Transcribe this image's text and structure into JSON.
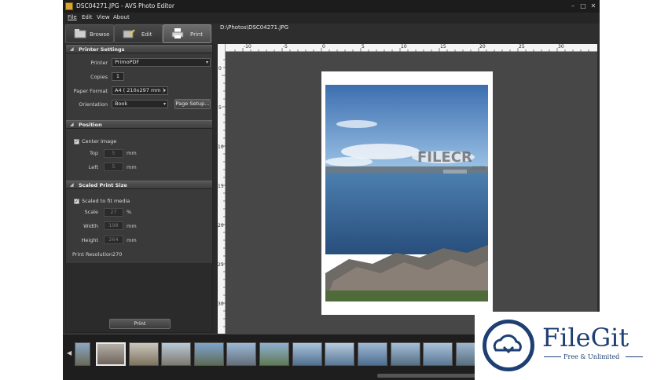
{
  "window": {
    "title": "DSC04271.JPG - AVS Photo Editor",
    "minimize": "–",
    "maximize": "□",
    "close": "✕"
  },
  "menu": [
    "File",
    "Edit",
    "View",
    "About"
  ],
  "tabs": [
    {
      "label": "Browse",
      "icon": "browse-icon",
      "active": false
    },
    {
      "label": "Edit",
      "icon": "edit-icon",
      "active": false
    },
    {
      "label": "Print",
      "icon": "printer-icon",
      "active": true
    }
  ],
  "file_path": "D:\\Photos\\DSC04271.JPG",
  "printer_settings": {
    "title": "Printer Settings",
    "printer_label": "Printer",
    "printer_value": "PrimoPDF",
    "copies_label": "Copies",
    "copies_value": "1",
    "paper_label": "Paper Format",
    "paper_value": "A4 ( 210x297 mm )",
    "orientation_label": "Orientation",
    "orientation_value": "Book",
    "page_setup_label": "Page Setup..."
  },
  "position": {
    "title": "Position",
    "center_label": "Center image",
    "center_checked": true,
    "top_label": "Top",
    "top_value": "5",
    "top_unit": "mm",
    "left_label": "Left",
    "left_value": "5",
    "left_unit": "mm"
  },
  "scaled": {
    "title": "Scaled Print Size",
    "fit_label": "Scaled to fit media",
    "fit_checked": true,
    "scale_label": "Scale",
    "scale_value": "27",
    "scale_unit": "%",
    "width_label": "Width",
    "width_value": "198",
    "width_unit": "mm",
    "height_label": "Height",
    "height_value": "264",
    "height_unit": "mm",
    "resolution_label": "Print Resolution",
    "resolution_value": "270"
  },
  "print_button": "Print",
  "ruler": {
    "h_unit": "cm",
    "h_ticks": [
      "-10",
      "-5",
      "0",
      "5",
      "10",
      "15",
      "20",
      "25",
      "30"
    ],
    "v_ticks": [
      "0",
      "5",
      "10",
      "15",
      "20",
      "25",
      "30"
    ]
  },
  "watermark": {
    "text": "FILECR",
    "sub": ".com"
  },
  "filmstrip": {
    "count": 13,
    "active_index": 1,
    "prev": "◀"
  },
  "filegit": {
    "name": "FileGit",
    "tagline": "Free & Unlimited"
  },
  "colors": {
    "accent": "#1e3f73",
    "panel": "#3a3a3a",
    "background": "#2e2e2e"
  }
}
